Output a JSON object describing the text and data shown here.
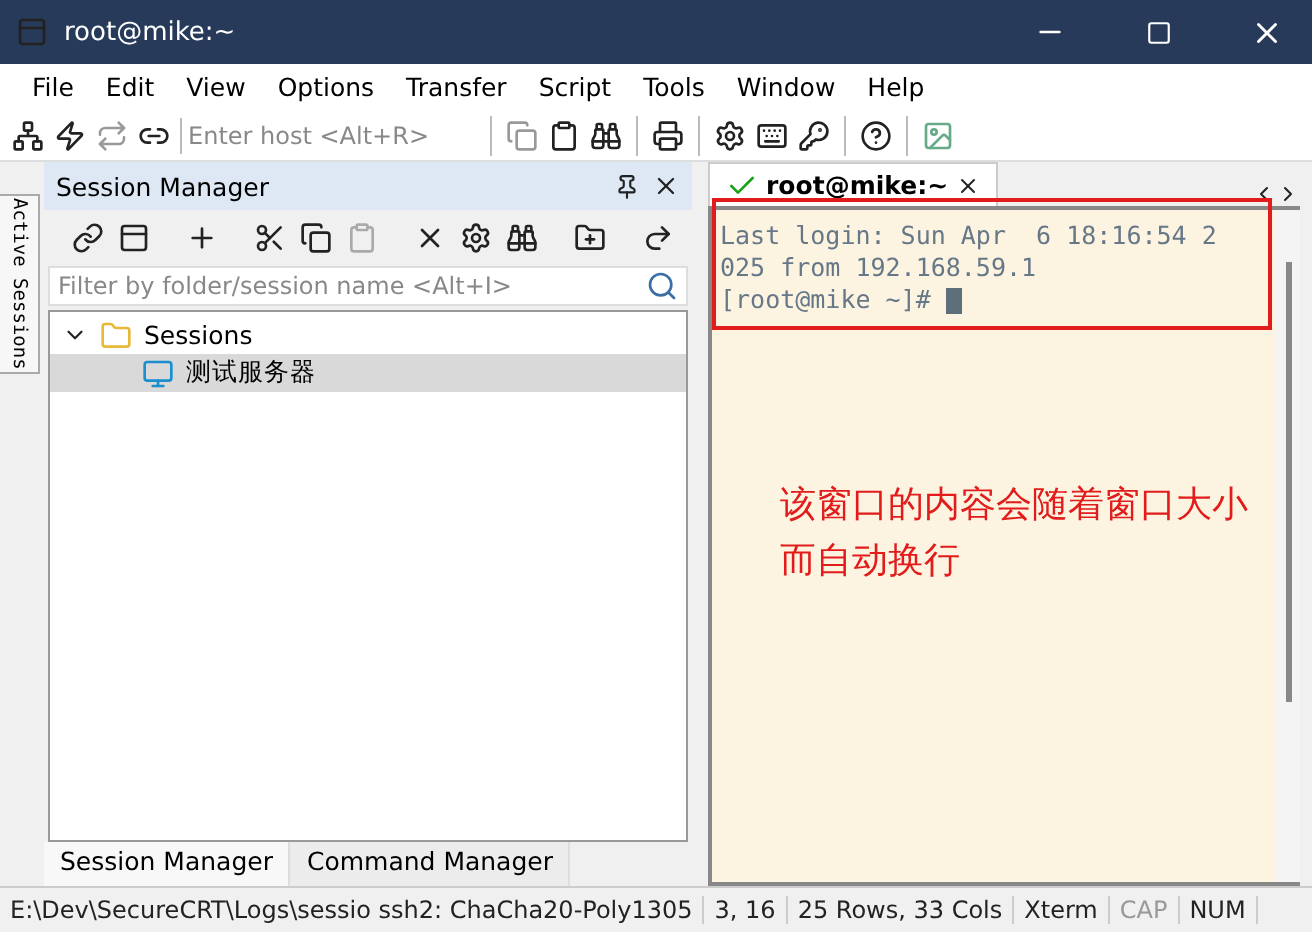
{
  "window": {
    "title": "root@mike:~"
  },
  "menu": [
    "File",
    "Edit",
    "View",
    "Options",
    "Transfer",
    "Script",
    "Tools",
    "Window",
    "Help"
  ],
  "toolbar": {
    "host_field": {
      "placeholder": "Enter host <Alt+R>"
    }
  },
  "side_tab": {
    "label": "Active Sessions"
  },
  "session_manager": {
    "title": "Session Manager",
    "filter": {
      "placeholder": "Filter by folder/session name <Alt+I>"
    },
    "tree": [
      {
        "label": "Sessions",
        "expanded": true,
        "selected": false,
        "children": [
          {
            "label": "测试服务器",
            "selected": true
          }
        ]
      }
    ],
    "bottom_tabs": [
      {
        "label": "Session Manager",
        "selected": true
      },
      {
        "label": "Command Manager",
        "selected": false
      }
    ]
  },
  "terminal": {
    "tabs": [
      {
        "label": "root@mike:~",
        "connected": true,
        "selected": true
      }
    ],
    "lines": [
      "Last login: Sun Apr  6 18:16:54 2",
      "025 from 192.168.59.1",
      "[root@mike ~]# "
    ],
    "annotation": "该窗口的内容会随着窗口大小而自动换行"
  },
  "status_bar": [
    {
      "text": "E:\\Dev\\SecureCRT\\Logs\\sessio ssh2: ChaCha20-Poly1305",
      "disabled": false
    },
    {
      "text": "3,  16",
      "disabled": false
    },
    {
      "text": "25 Rows, 33 Cols",
      "disabled": false
    },
    {
      "text": "Xterm",
      "disabled": false
    },
    {
      "text": "CAP",
      "disabled": true
    },
    {
      "text": "NUM",
      "disabled": false
    }
  ]
}
